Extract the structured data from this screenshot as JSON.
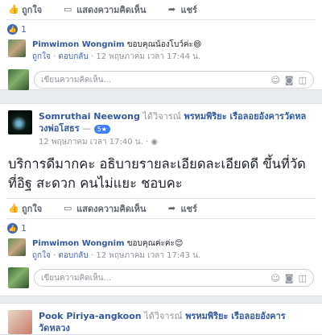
{
  "actions": {
    "like": "ถูกใจ",
    "comment": "แสดงความคิดเห็น",
    "share": "แชร์"
  },
  "post1": {
    "like_count": "1",
    "reply": {
      "name": "Pimwimon Wongnim",
      "text": "ขอบคุณน้องโบว์ค่ะ😄",
      "like": "ถูกใจ",
      "reply": "ตอบกลับ",
      "time": "12 พฤษภาคม เวลา 17:44 น."
    },
    "write_placeholder": "เขียนความคิดเห็น..."
  },
  "post2": {
    "author": "Somruthai Neewong",
    "shared_text": "ได้วิจารณ์",
    "page_name": "พรหมพิริยะ เรือลอยอังคารวัดหลวงพ่อโสธร",
    "dash": "—",
    "badge": "5★",
    "time": "12 พฤษภาคม เวลา 17:40 น.",
    "privacy_icon": "globe-icon",
    "body": "บริการดีมากคะ อธิบายรายละเอียดละเอียดดี ขึ้นที่วัดที่อิฐ สะดวก คนไม่แยะ ชอบคะ",
    "like_count": "1",
    "reply": {
      "name": "Pimwimon Wongnim",
      "text": "ขอบคุณค่ะค่ะ😊",
      "like": "ถูกใจ",
      "reply": "ตอบกลับ",
      "time": "12 พฤษภาคม เวลา 17:43 น."
    },
    "write_placeholder": "เขียนความคิดเห็น..."
  },
  "post3": {
    "author": "Pook Piriya-angkoon",
    "shared_text": "ได้วิจารณ์",
    "page_name": "พรหมพิริยะ เรือลอยอังคารวัดหลวง"
  },
  "colors": {
    "link": "#365899",
    "accent": "#4267b2",
    "bg": "#e9ebee"
  }
}
